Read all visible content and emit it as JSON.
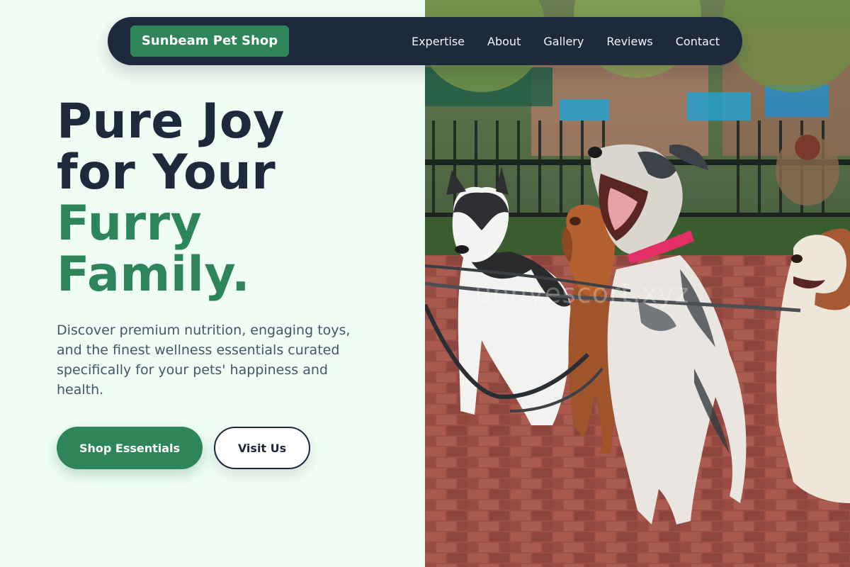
{
  "nav": {
    "brand": "Sunbeam Pet Shop",
    "links": [
      "Expertise",
      "About",
      "Gallery",
      "Reviews",
      "Contact"
    ]
  },
  "hero": {
    "title_line1": "Pure Joy",
    "title_line2": "for Your",
    "title_line3": "Furry",
    "title_line4": "Family.",
    "description": "Discover premium nutrition, engaging toys, and the finest wellness essentials curated specifically for your pets' happiness and health.",
    "primary_button": "Shop Essentials",
    "secondary_button": "Visit Us"
  },
  "image": {
    "subject": "four leashed dogs sitting on a brick sidewalk",
    "watermark": "unnyescort.xyz"
  },
  "colors": {
    "navy": "#1e293b",
    "green": "#2f855a",
    "mint_background": "#f0fdf4",
    "slate_text": "#475569"
  }
}
